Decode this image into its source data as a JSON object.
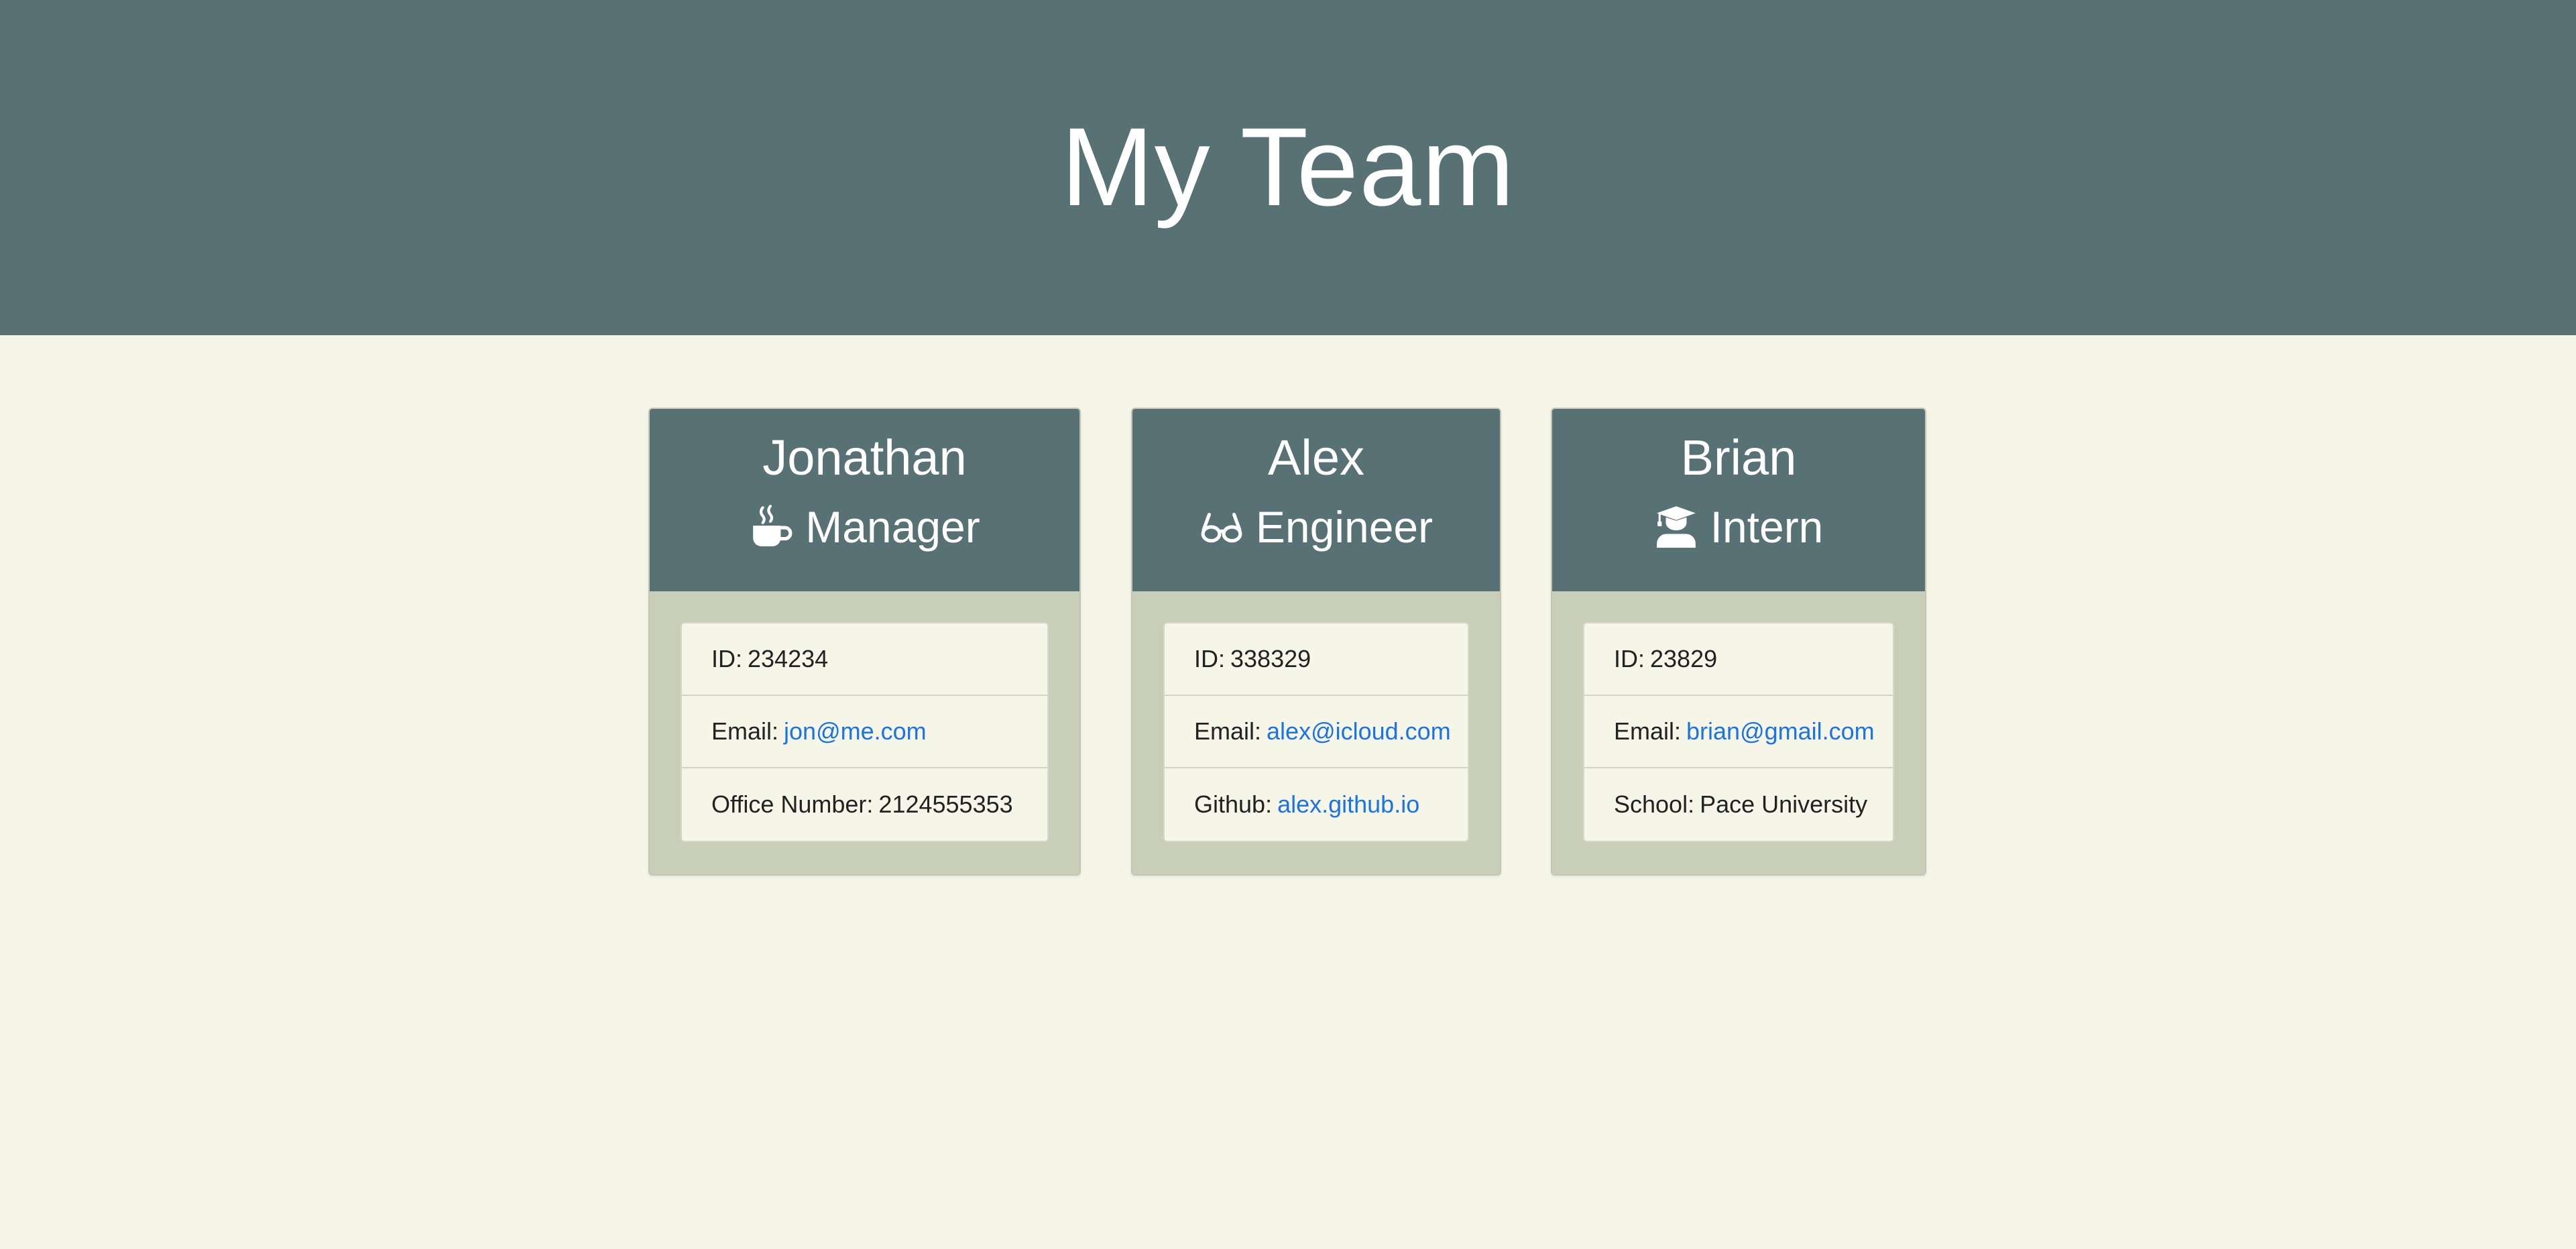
{
  "header": {
    "title": "My Team"
  },
  "colors": {
    "header_bg": "#577174",
    "page_bg": "#f5f5e8",
    "card_body_bg": "#c8ceb8",
    "link": "#1a73e8"
  },
  "cards": [
    {
      "name": "Jonathan",
      "role": "Manager",
      "role_icon": "coffee-mug-icon",
      "id_label": "ID:",
      "id": "234234",
      "email_label": "Email:",
      "email": "jon@me.com",
      "extra_label": "Office Number:",
      "extra_value": "2124555353"
    },
    {
      "name": "Alex",
      "role": "Engineer",
      "role_icon": "glasses-icon",
      "id_label": "ID:",
      "id": "338329",
      "email_label": "Email:",
      "email": "alex@icloud.com",
      "extra_label": "Github:",
      "extra_value": "alex.github.io"
    },
    {
      "name": "Brian",
      "role": "Intern",
      "role_icon": "graduate-icon",
      "id_label": "ID:",
      "id": "23829",
      "email_label": "Email:",
      "email": "brian@gmail.com",
      "extra_label": "School:",
      "extra_value": "Pace University"
    }
  ]
}
